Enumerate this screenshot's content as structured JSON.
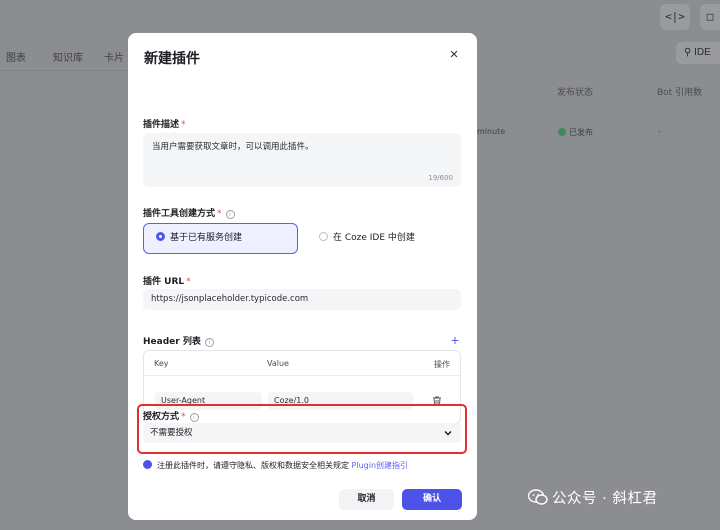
{
  "background": {
    "top_buttons": [
      "<|>",
      "□"
    ],
    "tabs": [
      "图表",
      "知识库",
      "卡片"
    ],
    "search_label": "IDE",
    "columns": [
      "发布状态",
      "Bot 引用数"
    ],
    "row": {
      "time_label": "minute",
      "status": "已发布",
      "refs": "-"
    }
  },
  "modal": {
    "title": "新建插件",
    "close_glyph": "×",
    "description": {
      "label": "插件描述",
      "required": "*",
      "value": "当用户需要获取文章时，可以调用此插件。",
      "counter": "19/600"
    },
    "creation_method": {
      "label": "插件工具创建方式",
      "required": "*",
      "info_glyph": "i",
      "options": [
        {
          "label": "基于已有服务创建",
          "selected": true
        },
        {
          "label": "在 Coze IDE 中创建",
          "selected": false
        }
      ]
    },
    "url": {
      "label": "插件 URL",
      "required": "*",
      "value": "https://jsonplaceholder.typicode.com"
    },
    "header_list": {
      "label": "Header 列表",
      "info_glyph": "i",
      "add_glyph": "+",
      "columns": {
        "key": "Key",
        "value": "Value",
        "action": "操作"
      },
      "rows": [
        {
          "key": "User-Agent",
          "value": "Coze/1.0"
        }
      ]
    },
    "auth": {
      "label": "授权方式",
      "required": "*",
      "info_glyph": "i",
      "value": "不需要授权"
    },
    "notice": {
      "text": "注册此插件时，请遵守隐私、版权和数据安全相关规定",
      "link": "Plugin创建指引"
    },
    "buttons": {
      "cancel": "取消",
      "confirm": "确认"
    }
  },
  "watermark": {
    "text": "公众号 · 斜杠君"
  },
  "colors": {
    "accent": "#4d53e8",
    "highlight_border": "#e1302f",
    "overlay": "#8c8d90",
    "required": "#e5484d"
  }
}
